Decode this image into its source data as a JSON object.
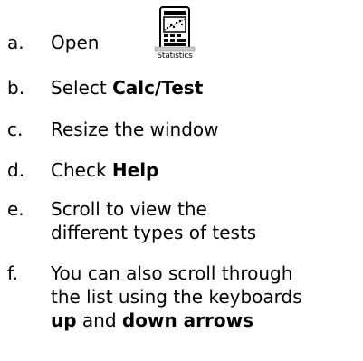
{
  "steps": [
    {
      "marker": "a.",
      "parts": [
        {
          "text": "Open ",
          "bold": false
        }
      ]
    },
    {
      "marker": "b.",
      "parts": [
        {
          "text": "Select ",
          "bold": false
        },
        {
          "text": "Calc/Test",
          "bold": true
        }
      ]
    },
    {
      "marker": "c.",
      "parts": [
        {
          "text": "Resize the window",
          "bold": false
        }
      ]
    },
    {
      "marker": "d.",
      "parts": [
        {
          "text": "Check ",
          "bold": false
        },
        {
          "text": "Help",
          "bold": true
        }
      ]
    },
    {
      "marker": "e.",
      "parts": [
        {
          "text": "Scroll to view the different types of tests",
          "bold": false
        }
      ]
    },
    {
      "marker": "f.",
      "parts": [
        {
          "text": "You can also scroll through the list using the keyboards ",
          "bold": false
        },
        {
          "text": "up",
          "bold": true
        },
        {
          "text": " and ",
          "bold": false
        },
        {
          "text": "down arrows",
          "bold": true
        }
      ]
    }
  ],
  "app_icon": {
    "name": "statistics-icon",
    "caption": "Statistics"
  }
}
